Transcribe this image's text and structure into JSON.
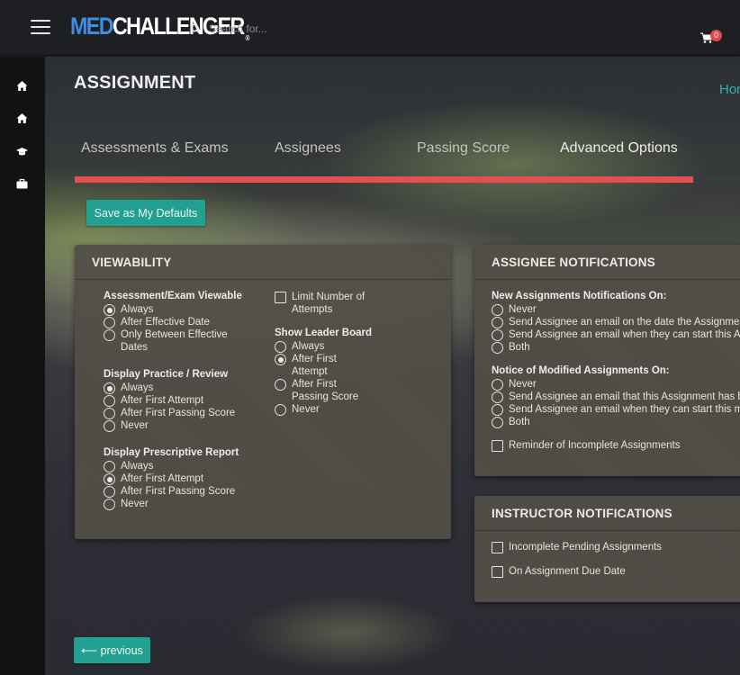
{
  "header": {
    "logo_part1": "MED",
    "logo_part2": "CHALLENGER",
    "logo_reg": "®",
    "search_placeholder": "Search for...",
    "cart_count": "0",
    "accent_color": "#3d8fe0",
    "badge_color": "#e0484a"
  },
  "sidebar": {
    "icons": [
      "home-icon",
      "home-icon",
      "graduation-cap-icon",
      "briefcase-icon"
    ]
  },
  "page": {
    "title": "ASSIGNMENT",
    "breadcrumb_home": "Hom"
  },
  "tabs": [
    {
      "label": "Assessments & Exams"
    },
    {
      "label": "Assignees"
    },
    {
      "label": "Passing Score"
    },
    {
      "label": "Advanced Options",
      "active": true
    }
  ],
  "progress": {
    "value_percent": 93,
    "color": "#e85250"
  },
  "buttons": {
    "save_defaults": "Save as My Defaults",
    "previous": "⟵ previous"
  },
  "viewability": {
    "heading": "VIEWABILITY",
    "assessment_viewable": {
      "title": "Assessment/Exam Viewable",
      "options": [
        "Always",
        "After Effective Date",
        "Only Between Effective",
        "Dates"
      ],
      "selected": 0
    },
    "practice_review": {
      "title": "Display Practice / Review",
      "options": [
        "Always",
        "After First Attempt",
        "After First Passing Score",
        "Never"
      ],
      "selected": 0
    },
    "prescriptive_report": {
      "title": "Display Prescriptive Report",
      "options": [
        "Always",
        "After First Attempt",
        "After First Passing Score",
        "Never"
      ],
      "selected": 1
    },
    "limit_attempts": {
      "line1": "Limit Number of",
      "line2": "Attempts",
      "checked": false
    },
    "leader_board": {
      "title": "Show Leader Board",
      "options": [
        "Always",
        "After First",
        "Attempt",
        "After First",
        "Passing Score",
        "Never"
      ],
      "selected": 1
    }
  },
  "assignee_notifications": {
    "heading": "ASSIGNEE NOTIFICATIONS",
    "new_assignments": {
      "title": "New Assignments Notifications On:",
      "options": [
        "Never",
        "Send Assignee an email on the date the Assignment",
        "Send Assignee an email when they can start this As",
        "Both"
      ]
    },
    "modified_assignments": {
      "title": "Notice of Modified Assignments On:",
      "options": [
        "Never",
        "Send Assignee an email that this Assignment has be",
        "Send Assignee an email when they can start this mo",
        "Both"
      ]
    },
    "reminder": {
      "label": "Reminder of Incomplete Assignments",
      "checked": false
    }
  },
  "instructor_notifications": {
    "heading": "INSTRUCTOR NOTIFICATIONS",
    "incomplete_pending": {
      "label": "Incomplete Pending Assignments",
      "checked": false
    },
    "due_date": {
      "label": "On Assignment Due Date",
      "checked": false
    }
  }
}
